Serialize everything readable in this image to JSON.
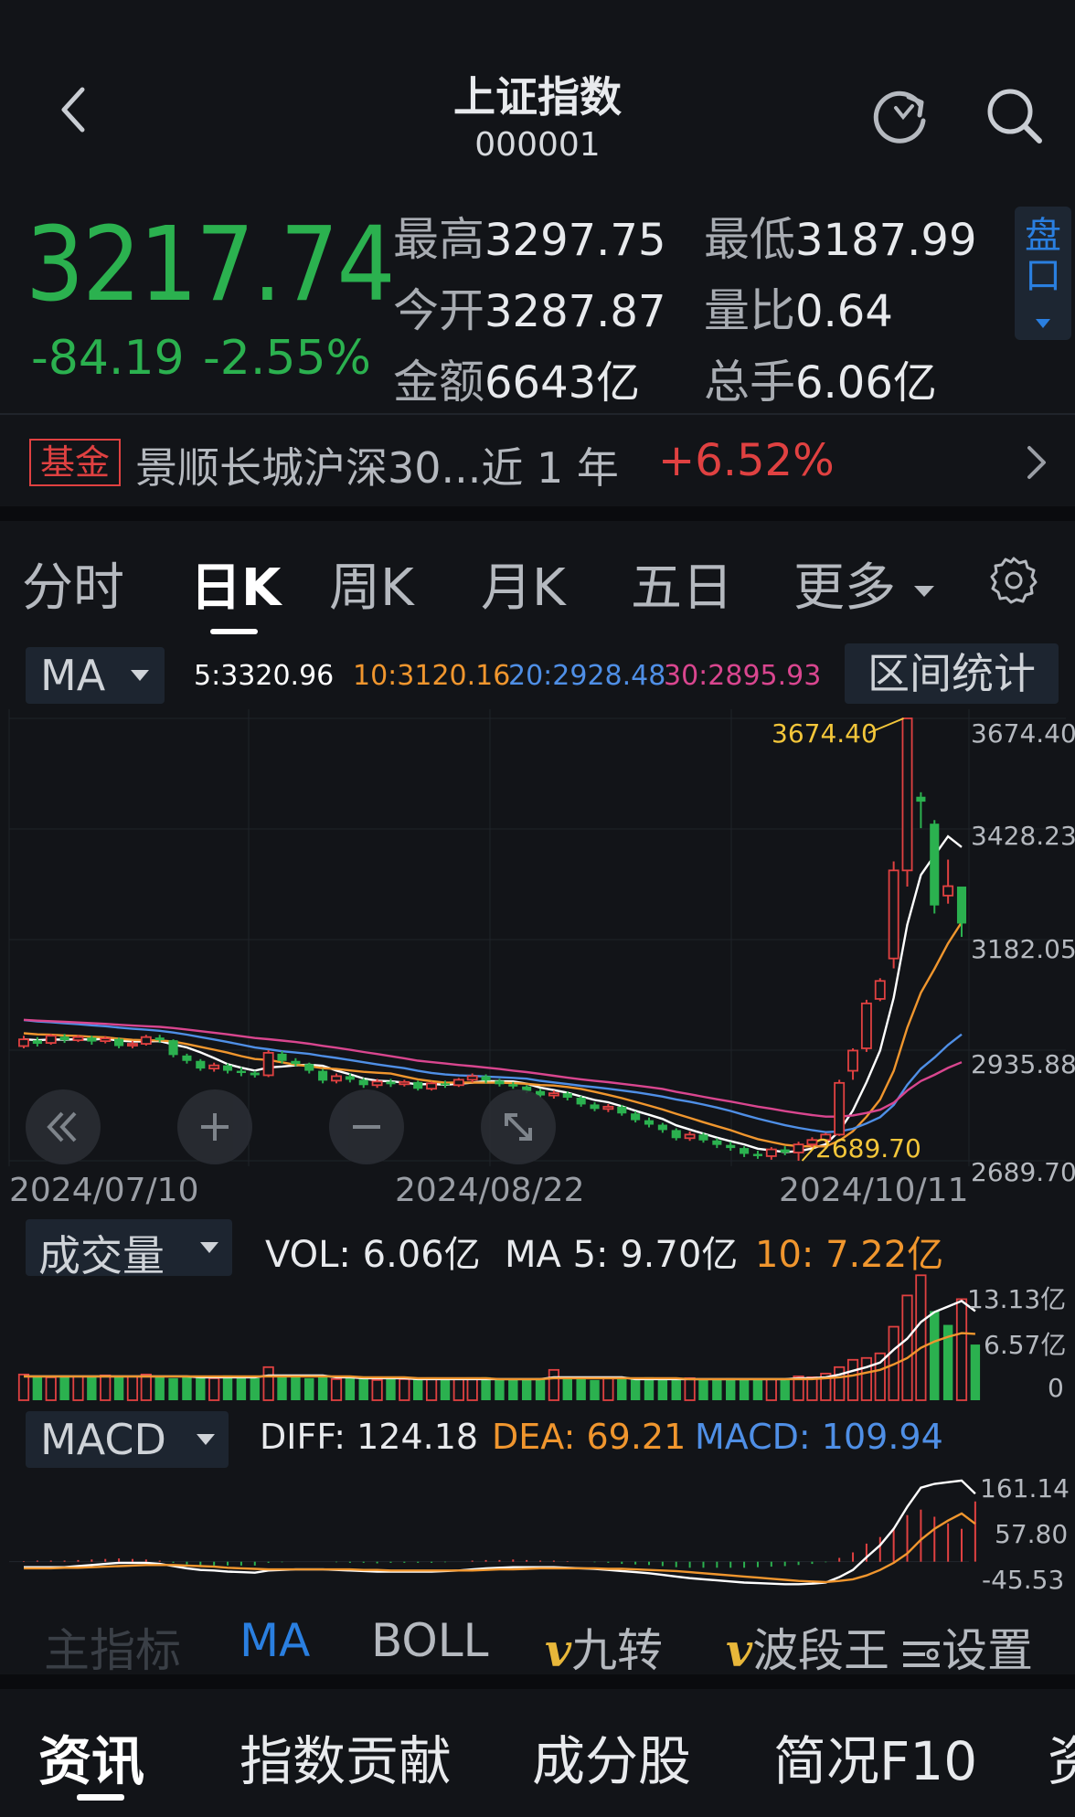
{
  "header": {
    "title": "上证指数",
    "code": "000001"
  },
  "quote": {
    "price": "3217.74",
    "change": "-84.19",
    "change_pct": "-2.55%",
    "stats": [
      {
        "label": "最高",
        "value": "3297.75"
      },
      {
        "label": "最低",
        "value": "3187.99"
      },
      {
        "label": "今开",
        "value": "3287.87"
      },
      {
        "label": "量比",
        "value": "0.64"
      },
      {
        "label": "金额",
        "value": "6643亿"
      },
      {
        "label": "总手",
        "value": "6.06亿"
      }
    ],
    "pankou_label": "盘口"
  },
  "fund": {
    "tag": "基金",
    "name": "景顺长城沪深30...近 1 年",
    "return": "+6.52%"
  },
  "tabs": [
    "分时",
    "日K",
    "周K",
    "月K",
    "五日",
    "更多"
  ],
  "active_tab": "日K",
  "ma_bar": {
    "selector": "MA",
    "ma5": "5:3320.96",
    "ma10": "10:3120.16",
    "ma20": "20:2928.48",
    "ma30": "30:2895.93",
    "range_stats": "区间统计"
  },
  "kline": {
    "y_labels": [
      "3674.40",
      "3428.23",
      "3182.05",
      "2935.88",
      "2689.70"
    ],
    "high_marker": "3674.40",
    "low_marker": "2689.70",
    "dates": [
      "2024/07/10",
      "2024/08/22",
      "2024/10/11"
    ]
  },
  "volume": {
    "selector": "成交量",
    "vol": "VOL:  6.06亿",
    "ma5": "MA 5:  9.70亿",
    "ma10": "10:  7.22亿",
    "y_labels": [
      "13.13亿",
      "6.57亿",
      "0"
    ]
  },
  "macd": {
    "selector": "MACD",
    "diff": "DIFF:  124.18",
    "dea": "DEA:  69.21",
    "macd": "MACD:  109.94",
    "y_labels": [
      "161.14",
      "57.80",
      "-45.53"
    ]
  },
  "indicator_bar": [
    "主指标",
    "MA",
    "BOLL",
    "九转",
    "波段王",
    "设置"
  ],
  "nav": [
    "资讯",
    "指数贡献",
    "成分股",
    "简况F10",
    "资"
  ],
  "colors": {
    "up": "#e04141",
    "down": "#2bb14f",
    "ma5": "#ffffff",
    "ma10": "#f0962e",
    "ma20": "#4f8fe6",
    "ma30": "#d9468f",
    "accent": "#2a7fe0"
  },
  "chart_data": [
    {
      "type": "candlestick",
      "title": "",
      "x_start": "2024/07/10",
      "x_end": "2024/10/11",
      "ylim": [
        2689.7,
        3674.4
      ],
      "y_ticks": [
        3674.4,
        3428.23,
        3182.05,
        2935.88,
        2689.7
      ],
      "candles": [
        {
          "o": 2945,
          "c": 2960,
          "h": 2968,
          "l": 2940
        },
        {
          "o": 2958,
          "c": 2950,
          "h": 2965,
          "l": 2944
        },
        {
          "o": 2952,
          "c": 2968,
          "h": 2972,
          "l": 2948
        },
        {
          "o": 2966,
          "c": 2958,
          "h": 2972,
          "l": 2952
        },
        {
          "o": 2958,
          "c": 2965,
          "h": 2970,
          "l": 2954
        },
        {
          "o": 2964,
          "c": 2955,
          "h": 2968,
          "l": 2948
        },
        {
          "o": 2956,
          "c": 2962,
          "h": 2967,
          "l": 2951
        },
        {
          "o": 2961,
          "c": 2945,
          "h": 2964,
          "l": 2940
        },
        {
          "o": 2946,
          "c": 2950,
          "h": 2956,
          "l": 2940
        },
        {
          "o": 2950,
          "c": 2965,
          "h": 2970,
          "l": 2946
        },
        {
          "o": 2964,
          "c": 2958,
          "h": 2970,
          "l": 2952
        },
        {
          "o": 2958,
          "c": 2925,
          "h": 2960,
          "l": 2920
        },
        {
          "o": 2924,
          "c": 2912,
          "h": 2928,
          "l": 2906
        },
        {
          "o": 2912,
          "c": 2895,
          "h": 2916,
          "l": 2890
        },
        {
          "o": 2895,
          "c": 2902,
          "h": 2908,
          "l": 2888
        },
        {
          "o": 2902,
          "c": 2890,
          "h": 2906,
          "l": 2884
        },
        {
          "o": 2890,
          "c": 2885,
          "h": 2898,
          "l": 2878
        },
        {
          "o": 2886,
          "c": 2880,
          "h": 2890,
          "l": 2875
        },
        {
          "o": 2880,
          "c": 2930,
          "h": 2936,
          "l": 2876
        },
        {
          "o": 2928,
          "c": 2912,
          "h": 2934,
          "l": 2906
        },
        {
          "o": 2912,
          "c": 2905,
          "h": 2918,
          "l": 2900
        },
        {
          "o": 2905,
          "c": 2890,
          "h": 2908,
          "l": 2884
        },
        {
          "o": 2890,
          "c": 2868,
          "h": 2894,
          "l": 2862
        },
        {
          "o": 2868,
          "c": 2878,
          "h": 2884,
          "l": 2862
        },
        {
          "o": 2878,
          "c": 2870,
          "h": 2884,
          "l": 2864
        },
        {
          "o": 2870,
          "c": 2858,
          "h": 2874,
          "l": 2852
        },
        {
          "o": 2858,
          "c": 2866,
          "h": 2872,
          "l": 2852
        },
        {
          "o": 2866,
          "c": 2860,
          "h": 2872,
          "l": 2854
        },
        {
          "o": 2860,
          "c": 2865,
          "h": 2870,
          "l": 2855
        },
        {
          "o": 2865,
          "c": 2850,
          "h": 2868,
          "l": 2846
        },
        {
          "o": 2850,
          "c": 2862,
          "h": 2866,
          "l": 2846
        },
        {
          "o": 2862,
          "c": 2858,
          "h": 2868,
          "l": 2852
        },
        {
          "o": 2858,
          "c": 2870,
          "h": 2874,
          "l": 2854
        },
        {
          "o": 2870,
          "c": 2878,
          "h": 2884,
          "l": 2864
        },
        {
          "o": 2878,
          "c": 2868,
          "h": 2882,
          "l": 2862
        },
        {
          "o": 2868,
          "c": 2860,
          "h": 2872,
          "l": 2855
        },
        {
          "o": 2860,
          "c": 2855,
          "h": 2865,
          "l": 2850
        },
        {
          "o": 2855,
          "c": 2845,
          "h": 2858,
          "l": 2840
        },
        {
          "o": 2845,
          "c": 2835,
          "h": 2850,
          "l": 2830
        },
        {
          "o": 2835,
          "c": 2840,
          "h": 2846,
          "l": 2828
        },
        {
          "o": 2840,
          "c": 2830,
          "h": 2844,
          "l": 2824
        },
        {
          "o": 2830,
          "c": 2815,
          "h": 2834,
          "l": 2810
        },
        {
          "o": 2815,
          "c": 2805,
          "h": 2820,
          "l": 2800
        },
        {
          "o": 2805,
          "c": 2810,
          "h": 2816,
          "l": 2798
        },
        {
          "o": 2810,
          "c": 2795,
          "h": 2814,
          "l": 2790
        },
        {
          "o": 2795,
          "c": 2780,
          "h": 2800,
          "l": 2775
        },
        {
          "o": 2780,
          "c": 2770,
          "h": 2786,
          "l": 2764
        },
        {
          "o": 2770,
          "c": 2758,
          "h": 2774,
          "l": 2752
        },
        {
          "o": 2758,
          "c": 2740,
          "h": 2762,
          "l": 2735
        },
        {
          "o": 2740,
          "c": 2748,
          "h": 2755,
          "l": 2734
        },
        {
          "o": 2748,
          "c": 2735,
          "h": 2752,
          "l": 2730
        },
        {
          "o": 2735,
          "c": 2725,
          "h": 2740,
          "l": 2718
        },
        {
          "o": 2725,
          "c": 2718,
          "h": 2732,
          "l": 2712
        },
        {
          "o": 2718,
          "c": 2705,
          "h": 2722,
          "l": 2698
        },
        {
          "o": 2705,
          "c": 2700,
          "h": 2712,
          "l": 2694
        },
        {
          "o": 2700,
          "c": 2715,
          "h": 2720,
          "l": 2692
        },
        {
          "o": 2715,
          "c": 2708,
          "h": 2722,
          "l": 2702
        },
        {
          "o": 2708,
          "c": 2726,
          "h": 2732,
          "l": 2689.7
        },
        {
          "o": 2726,
          "c": 2736,
          "h": 2742,
          "l": 2720
        },
        {
          "o": 2736,
          "c": 2748,
          "h": 2752,
          "l": 2730
        },
        {
          "o": 2748,
          "c": 2863,
          "h": 2870,
          "l": 2745
        },
        {
          "o": 2890,
          "c": 2935,
          "h": 2940,
          "l": 2870
        },
        {
          "o": 2940,
          "c": 3040,
          "h": 3048,
          "l": 2932
        },
        {
          "o": 3050,
          "c": 3090,
          "h": 3096,
          "l": 3045
        },
        {
          "o": 3140,
          "c": 3336,
          "h": 3356,
          "l": 3118
        },
        {
          "o": 3336,
          "c": 3674.4,
          "h": 3674.4,
          "l": 3300
        },
        {
          "o": 3500,
          "c": 3489,
          "h": 3510,
          "l": 3430
        },
        {
          "o": 3440,
          "c": 3258,
          "h": 3448,
          "l": 3240
        },
        {
          "o": 3280,
          "c": 3301,
          "h": 3360,
          "l": 3262
        },
        {
          "o": 3300,
          "c": 3217.74,
          "h": 3297.75,
          "l": 3187.99
        }
      ]
    },
    {
      "type": "bar",
      "title": "成交量",
      "ylim": [
        0,
        13.13
      ],
      "y_unit": "亿",
      "values": [
        2.8,
        2.6,
        2.5,
        2.7,
        2.6,
        2.5,
        2.7,
        2.6,
        2.6,
        2.8,
        2.5,
        2.4,
        2.6,
        2.5,
        2.4,
        2.7,
        2.5,
        2.4,
        3.6,
        2.6,
        2.5,
        2.4,
        2.6,
        2.3,
        2.4,
        2.5,
        2.2,
        2.4,
        2.3,
        2.3,
        2.4,
        2.2,
        2.3,
        2.4,
        2.5,
        2.3,
        2.2,
        2.3,
        2.4,
        3.3,
        2.4,
        2.3,
        2.2,
        2.5,
        2.4,
        2.3,
        2.5,
        2.3,
        2.2,
        2.4,
        2.3,
        2.2,
        2.4,
        2.3,
        2.2,
        2.3,
        2.4,
        2.6,
        2.5,
        2.9,
        3.6,
        4.4,
        4.6,
        5.1,
        8.0,
        11.4,
        13.6,
        9.7,
        8.2,
        11.0,
        6.06
      ],
      "up": [
        true,
        false,
        true,
        false,
        true,
        false,
        true,
        false,
        true,
        true,
        false,
        false,
        false,
        false,
        true,
        false,
        false,
        false,
        true,
        false,
        false,
        false,
        false,
        true,
        false,
        false,
        true,
        false,
        true,
        false,
        true,
        false,
        true,
        true,
        false,
        false,
        false,
        false,
        false,
        true,
        false,
        false,
        false,
        true,
        false,
        false,
        false,
        false,
        false,
        true,
        false,
        false,
        false,
        false,
        false,
        true,
        false,
        true,
        true,
        true,
        true,
        true,
        true,
        true,
        true,
        true,
        true,
        false,
        false,
        true,
        false
      ],
      "ma5": [
        2.6,
        2.6,
        2.6,
        2.6,
        2.6,
        2.6,
        2.6,
        2.6,
        2.6,
        2.6,
        2.6,
        2.6,
        2.6,
        2.5,
        2.5,
        2.5,
        2.5,
        2.5,
        2.7,
        2.7,
        2.7,
        2.7,
        2.7,
        2.5,
        2.5,
        2.4,
        2.4,
        2.4,
        2.4,
        2.3,
        2.3,
        2.3,
        2.3,
        2.3,
        2.3,
        2.3,
        2.3,
        2.3,
        2.3,
        2.5,
        2.5,
        2.5,
        2.5,
        2.5,
        2.5,
        2.3,
        2.3,
        2.3,
        2.3,
        2.3,
        2.3,
        2.3,
        2.3,
        2.3,
        2.3,
        2.3,
        2.3,
        2.4,
        2.4,
        2.5,
        2.8,
        3.2,
        3.6,
        4.1,
        5.5,
        6.7,
        8.5,
        9.6,
        10.2,
        10.8,
        9.7
      ],
      "ma10": [
        2.6,
        2.6,
        2.6,
        2.6,
        2.6,
        2.6,
        2.6,
        2.6,
        2.6,
        2.6,
        2.6,
        2.6,
        2.6,
        2.6,
        2.6,
        2.6,
        2.6,
        2.6,
        2.6,
        2.6,
        2.6,
        2.6,
        2.6,
        2.6,
        2.6,
        2.5,
        2.5,
        2.5,
        2.5,
        2.4,
        2.4,
        2.4,
        2.4,
        2.4,
        2.4,
        2.3,
        2.3,
        2.3,
        2.3,
        2.4,
        2.4,
        2.4,
        2.4,
        2.4,
        2.4,
        2.4,
        2.4,
        2.4,
        2.4,
        2.3,
        2.3,
        2.3,
        2.3,
        2.3,
        2.3,
        2.3,
        2.3,
        2.3,
        2.3,
        2.4,
        2.5,
        2.7,
        3.0,
        3.3,
        3.9,
        4.6,
        5.7,
        6.4,
        6.9,
        7.3,
        7.22
      ]
    },
    {
      "type": "line",
      "title": "MACD",
      "ylim": [
        -45.53,
        161.14
      ],
      "series": [
        {
          "name": "DIFF",
          "values": [
            -10,
            -10,
            -10,
            -10,
            -8,
            -6,
            -4,
            -2,
            -2,
            -2,
            -4,
            -8,
            -12,
            -15,
            -16,
            -18,
            -19,
            -20,
            -16,
            -15,
            -14,
            -14,
            -14,
            -15,
            -16,
            -17,
            -18,
            -18,
            -18,
            -18,
            -18,
            -17,
            -16,
            -14,
            -12,
            -11,
            -10,
            -10,
            -10,
            -10,
            -11,
            -12,
            -13,
            -15,
            -17,
            -19,
            -21,
            -24,
            -27,
            -30,
            -32,
            -34,
            -36,
            -38,
            -39,
            -40,
            -41,
            -41,
            -40,
            -38,
            -28,
            -15,
            8,
            30,
            60,
            100,
            135,
            142,
            145,
            148,
            124.18
          ]
        },
        {
          "name": "DEA",
          "values": [
            -12,
            -12,
            -12,
            -11,
            -11,
            -10,
            -9,
            -8,
            -7,
            -6,
            -6,
            -6,
            -7,
            -8,
            -9,
            -11,
            -12,
            -13,
            -14,
            -14,
            -14,
            -14,
            -14,
            -14,
            -14,
            -15,
            -15,
            -16,
            -16,
            -16,
            -16,
            -16,
            -16,
            -16,
            -15,
            -14,
            -14,
            -13,
            -12,
            -12,
            -12,
            -12,
            -12,
            -13,
            -13,
            -14,
            -15,
            -16,
            -17,
            -19,
            -21,
            -23,
            -25,
            -27,
            -29,
            -31,
            -33,
            -35,
            -36,
            -37,
            -35,
            -32,
            -25,
            -15,
            -2,
            15,
            40,
            60,
            75,
            88,
            69.21
          ]
        }
      ],
      "histogram": [
        1,
        2,
        2,
        2,
        3,
        4,
        5,
        6,
        5,
        4,
        2,
        -2,
        -5,
        -7,
        -7,
        -7,
        -7,
        -7,
        -2,
        -1,
        0,
        0,
        0,
        -1,
        -2,
        -2,
        -3,
        -2,
        -2,
        -2,
        -2,
        -1,
        0,
        2,
        3,
        3,
        4,
        3,
        2,
        2,
        1,
        0,
        -1,
        -2,
        -4,
        -5,
        -6,
        -8,
        -10,
        -11,
        -11,
        -11,
        -11,
        -11,
        -10,
        -9,
        -8,
        -6,
        -4,
        -1,
        7,
        17,
        33,
        45,
        62,
        85,
        95,
        82,
        70,
        60,
        109.94
      ]
    }
  ]
}
